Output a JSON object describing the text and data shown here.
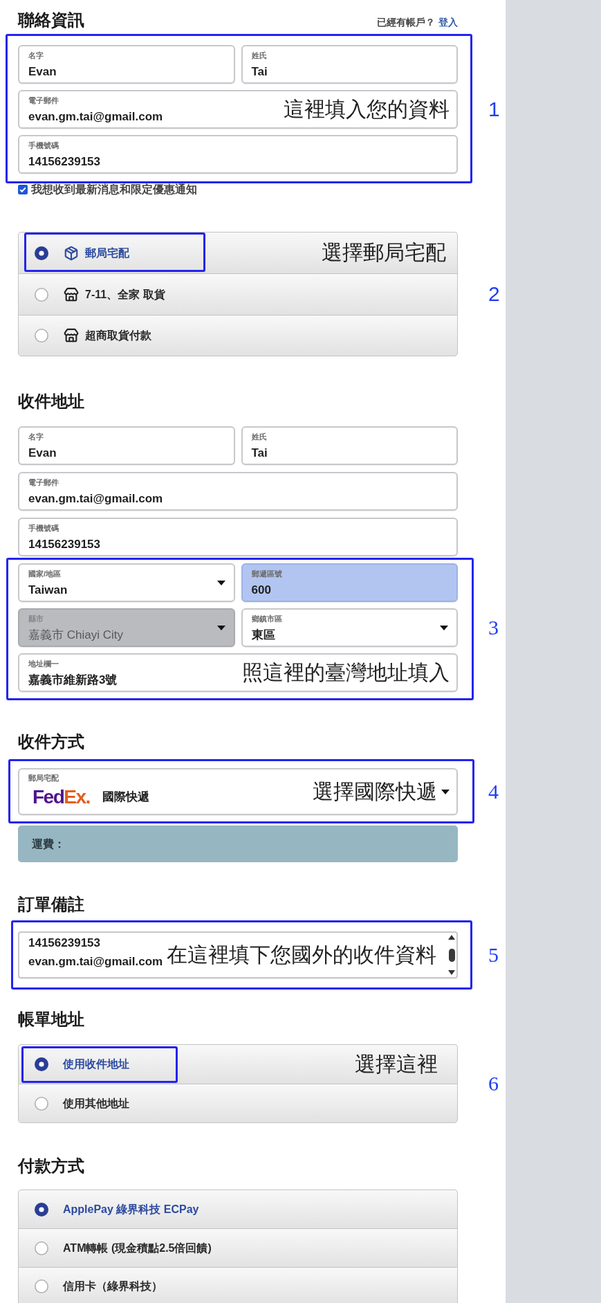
{
  "contact": {
    "title": "聯絡資訊",
    "login_prompt": "已經有帳戶？",
    "login_link": "登入",
    "annotation": {
      "number": "1"
    },
    "rows": [
      [
        {
          "label": "名字",
          "value": "Evan"
        },
        {
          "label": "姓氏",
          "value": "Tai"
        }
      ],
      [
        {
          "label": "電子郵件",
          "value": "evan.gm.tai@gmail.com",
          "note": "這裡填入您的資料"
        }
      ],
      [
        {
          "label": "手機號碼",
          "value": "14156239153"
        }
      ]
    ],
    "newsletter": {
      "label": "我想收到最新消息和限定優惠通知",
      "checked": true
    }
  },
  "delivery": {
    "annotation": {
      "number": "2"
    },
    "items": [
      {
        "kind": "home",
        "label": "郵局宅配",
        "selected": true,
        "note": "選擇郵局宅配"
      },
      {
        "kind": "store",
        "label": "7-11、全家 取貨",
        "selected": false
      },
      {
        "kind": "store",
        "label": "超商取貨付款",
        "selected": false
      }
    ]
  },
  "shipping_address": {
    "title": "收件地址",
    "rows": [
      [
        {
          "label": "名字",
          "value": "Evan"
        },
        {
          "label": "姓氏",
          "value": "Tai"
        }
      ],
      [
        {
          "label": "電子郵件",
          "value": "evan.gm.tai@gmail.com"
        }
      ],
      [
        {
          "label": "手機號碼",
          "value": "14156239153"
        }
      ]
    ],
    "annotation": {
      "number": "3",
      "rows": [
        [
          {
            "kind": "select",
            "label": "國家/地區",
            "value": "Taiwan",
            "disabled": false,
            "highlighted": false
          },
          {
            "kind": "text",
            "label": "郵遞區號",
            "value": "600",
            "disabled": false,
            "highlighted": true
          }
        ],
        [
          {
            "kind": "select",
            "label": "縣市",
            "value": "嘉義市 Chiayi City",
            "disabled": true,
            "highlighted": false
          },
          {
            "kind": "select",
            "label": "鄉鎮市區",
            "value": "東區",
            "disabled": false,
            "highlighted": false
          }
        ],
        [
          {
            "kind": "text",
            "label": "地址欄一",
            "value": "嘉義市維新路3號",
            "disabled": false,
            "highlighted": false,
            "note": "照這裡的臺灣地址填入"
          }
        ]
      ]
    }
  },
  "shipping_method": {
    "title": "收件方式",
    "annotation": {
      "number": "4"
    },
    "select": {
      "label": "郵局宅配",
      "logo": [
        {
          "text": "Fed",
          "color": "#4d148c"
        },
        {
          "text": "Ex.",
          "color": "#e2601e"
        }
      ],
      "value": "國際快遞",
      "note": "選擇國際快遞"
    },
    "fee_label": "運費："
  },
  "order_note": {
    "title": "訂單備註",
    "annotation": {
      "number": "5"
    },
    "lines": [
      "14156239153",
      "evan.gm.tai@gmail.com"
    ],
    "note": "在這裡填下您國外的收件資料"
  },
  "billing_address": {
    "title": "帳單地址",
    "annotation": {
      "number": "6"
    },
    "options": [
      {
        "label": "使用收件地址",
        "selected": true,
        "note": "選擇這裡"
      },
      {
        "label": "使用其他地址",
        "selected": false
      }
    ]
  },
  "payment": {
    "title": "付款方式",
    "options": [
      {
        "label": "ApplePay 綠界科技 ECPay",
        "selected": true
      },
      {
        "label": "ATM轉帳 (現金積點2.5倍回饋)",
        "selected": false
      },
      {
        "label": "信用卡（綠界科技）",
        "selected": false
      }
    ]
  }
}
